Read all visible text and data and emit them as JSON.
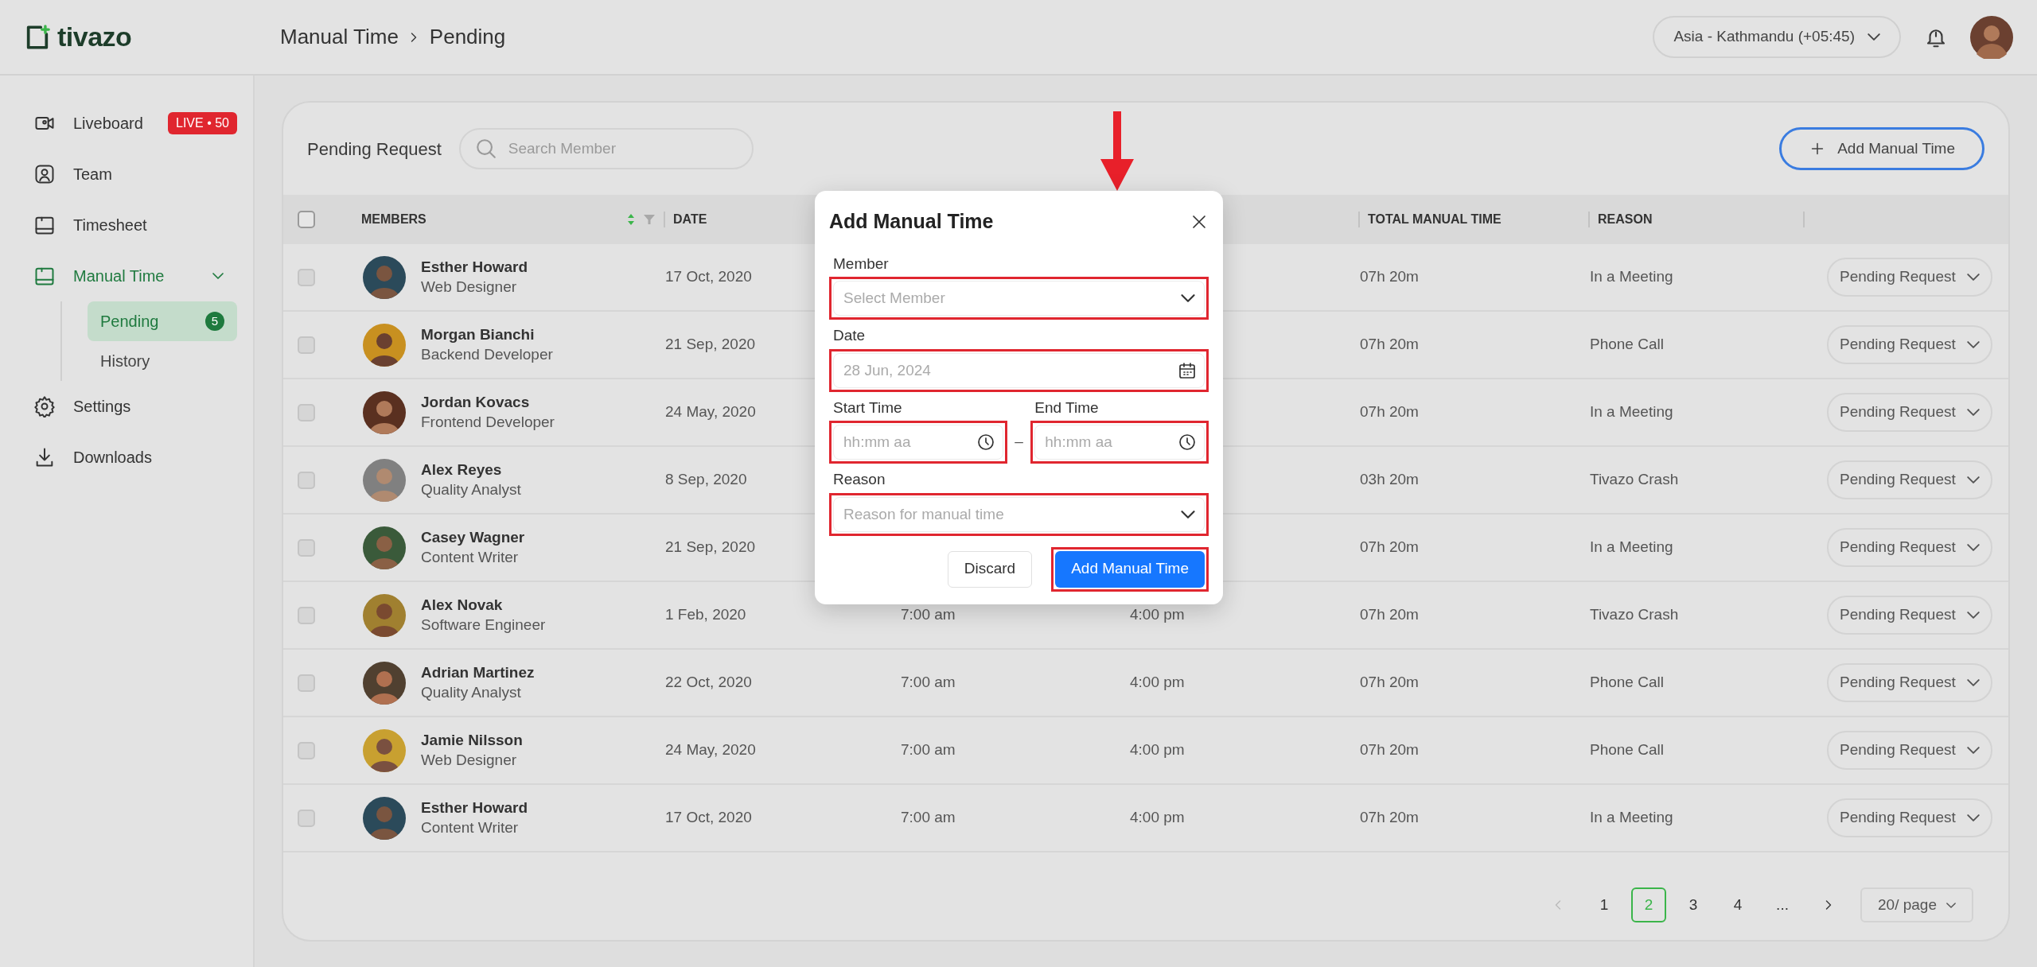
{
  "header": {
    "logo": "tivazo",
    "breadcrumb": [
      "Manual Time",
      "Pending"
    ],
    "timezone": "Asia - Kathmandu (+05:45)"
  },
  "sidebar": {
    "items": [
      {
        "label": "Liveboard",
        "selected": false,
        "badge": "LIVE • 50"
      },
      {
        "label": "Team",
        "selected": false
      },
      {
        "label": "Timesheet",
        "selected": false
      },
      {
        "label": "Manual Time",
        "selected": true,
        "expanded": true,
        "children": [
          {
            "label": "Pending",
            "selected": true,
            "count": "5"
          },
          {
            "label": "History",
            "selected": false
          }
        ]
      },
      {
        "label": "Settings",
        "selected": false
      },
      {
        "label": "Downloads",
        "selected": false
      }
    ]
  },
  "panel": {
    "title": "Pending Request",
    "search": {
      "placeholder": "Search Member"
    },
    "add_button": "Add Manual Time"
  },
  "table": {
    "columns": [
      {
        "label": "MEMBERS",
        "kind": "sortable"
      },
      {
        "label": "DATE",
        "kind": "plain"
      },
      {
        "kind": "plain"
      },
      {
        "kind": "plain"
      },
      {
        "label": "TOTAL MANUAL TIME",
        "kind": "plain"
      },
      {
        "label": "REASON",
        "kind": "plain"
      },
      {
        "kind": "plain"
      }
    ],
    "rows": [
      {
        "checked": false,
        "name": "Esther Howard",
        "role": "Web Designer",
        "date": "17 Oct, 2020",
        "total": "07h 20m",
        "reason": "In  a Meeting",
        "status": "Pending Request"
      },
      {
        "checked": false,
        "name": "Morgan Bianchi",
        "role": "Backend Developer",
        "date": "21 Sep, 2020",
        "total": "07h 20m",
        "reason": "Phone Call",
        "status": "Pending Request"
      },
      {
        "checked": false,
        "name": "Jordan Kovacs",
        "role": "Frontend Developer",
        "date": "24 May, 2020",
        "total": "07h 20m",
        "reason": "In  a Meeting",
        "status": "Pending Request"
      },
      {
        "checked": false,
        "name": "Alex Reyes",
        "role": "Quality Analyst",
        "date": "8 Sep, 2020",
        "total": "03h 20m",
        "reason": "Tivazo Crash",
        "status": "Pending Request"
      },
      {
        "checked": false,
        "name": "Casey Wagner",
        "role": "Content Writer",
        "date": "21 Sep, 2020",
        "total": "07h 20m",
        "reason": "In  a Meeting",
        "status": "Pending Request"
      },
      {
        "checked": false,
        "name": "Alex Novak",
        "role": "Software Engineer",
        "date": "1 Feb, 2020",
        "start": "7:00 am",
        "end": "4:00 pm",
        "total": "07h 20m",
        "reason": "Tivazo Crash",
        "status": "Pending Request"
      },
      {
        "checked": false,
        "name": "Adrian Martinez",
        "role": "Quality Analyst",
        "date": "22 Oct, 2020",
        "start": "7:00 am",
        "end": "4:00 pm",
        "total": "07h 20m",
        "reason": "Phone Call",
        "status": "Pending Request"
      },
      {
        "checked": false,
        "name": "Jamie Nilsson",
        "role": "Web Designer",
        "date": "24 May, 2020",
        "start": "7:00 am",
        "end": "4:00 pm",
        "total": "07h 20m",
        "reason": "Phone Call",
        "status": "Pending Request"
      },
      {
        "checked": false,
        "name": "Esther Howard",
        "role": "Content Writer",
        "date": "17 Oct, 2020",
        "start": "7:00 am",
        "end": "4:00 pm",
        "total": "07h 20m",
        "reason": "In  a Meeting",
        "status": "Pending Request"
      }
    ],
    "header_checked": false
  },
  "pagination": {
    "pages": [
      {
        "label": "1",
        "selected": false
      },
      {
        "label": "2",
        "selected": true
      },
      {
        "label": "3",
        "selected": false
      },
      {
        "label": "4",
        "selected": false
      },
      {
        "label": "...",
        "selected": false
      }
    ],
    "page_size": "20/ page"
  },
  "modal": {
    "title": "Add Manual Time",
    "fields": [
      {
        "kind": "select",
        "label": "Member",
        "placeholder": "Select Member",
        "highlighted": true
      },
      {
        "kind": "date",
        "label": "Date",
        "placeholder": "28 Jun, 2024",
        "highlighted": true
      },
      {
        "kind": "time_range",
        "separator": "–",
        "start": {
          "label": "Start Time",
          "placeholder": "hh:mm aa",
          "highlighted": true
        },
        "end": {
          "label": "End Time",
          "placeholder": "hh:mm aa",
          "highlighted": true
        }
      },
      {
        "kind": "select",
        "label": "Reason",
        "placeholder": "Reason for manual time",
        "highlighted": true
      }
    ],
    "buttons": [
      {
        "kind": "secondary",
        "label": "Discard",
        "highlighted": false
      },
      {
        "kind": "primary",
        "label": "Add Manual Time",
        "highlighted": true
      }
    ]
  }
}
